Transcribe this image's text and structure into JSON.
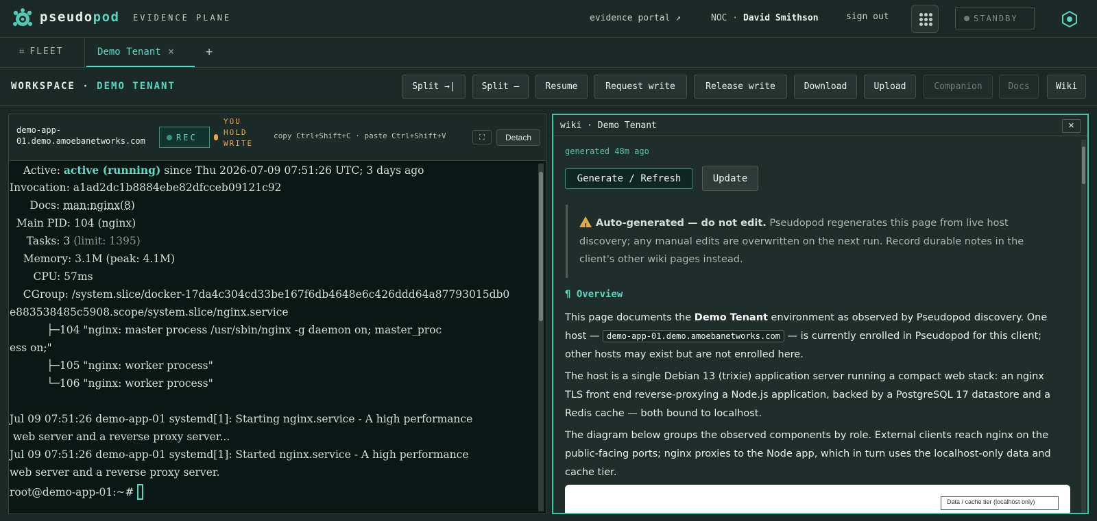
{
  "app": {
    "brand_prefix": "pseudo",
    "brand_suffix": "pod",
    "subtitle": "EVIDENCE PLANE",
    "icons": {
      "logo": "pseudopod-logo",
      "apps": "grid-dots-icon",
      "status": "hexagon-icon"
    }
  },
  "topbar": {
    "evidence_portal": "evidence portal ↗",
    "user_role": "NOC ·",
    "user_name": "David Smithson",
    "sign_out": "sign out",
    "standby": "STANDBY"
  },
  "tabs": {
    "fleet_icon": "⌗",
    "fleet_label": "FLEET",
    "active_label": "Demo Tenant",
    "close_glyph": "×",
    "add_glyph": "+"
  },
  "workspace": {
    "title_prefix": "WORKSPACE ·",
    "title_tenant": "DEMO TENANT",
    "buttons": {
      "split_v": "Split →|",
      "split_h": "Split —",
      "resume": "Resume",
      "request_write": "Request write",
      "release_write": "Release write",
      "download": "Download",
      "upload": "Upload",
      "companion": "Companion",
      "docs": "Docs",
      "wiki": "Wiki"
    }
  },
  "terminal": {
    "host": "demo-app-01.demo.amoebanetworks.com",
    "rec": "REC",
    "hold_write": "YOU HOLD WRITE",
    "copy_hint": "copy Ctrl+Shift+C · paste Ctrl+Shift+V",
    "expand_icon": "⛶",
    "detach": "Detach",
    "lines": {
      "active_label": "    Active: ",
      "active_state": "active (running)",
      "active_rest": " since Thu 2026-07-09 07:51:26 UTC; 3 days ago",
      "invocation": "Invocation: a1ad2dc1b8884ebe82dfcceb09121c92",
      "docs_label": "      Docs: ",
      "docs_link": "man:nginx(8)",
      "main_pid": "  Main PID: 104 (nginx)",
      "tasks_label": "     Tasks: 3 ",
      "tasks_limit": "(limit: 1395)",
      "memory": "    Memory: 3.1M (peak: 4.1M)",
      "cpu": "       CPU: 57ms",
      "cgroup1": "    CGroup: /system.slice/docker-17da4c304cd33be167f6db4648e6c426ddd64a87793015db0",
      "cgroup2": "e883538485c5908.scope/system.slice/nginx.service",
      "proc1_tree": "           ├─",
      "proc1": "104 \"nginx: master process /usr/sbin/nginx -g daemon on; master_proc",
      "proc1_wrap": "ess on;\"",
      "proc2_tree": "           ├─",
      "proc2": "105 \"nginx: worker process\"",
      "proc3_tree": "           └─",
      "proc3": "106 \"nginx: worker process\"",
      "log1a": "Jul 09 07:51:26 demo-app-01 systemd[1]: Starting nginx.service - A high performance",
      "log1b": " web server and a reverse proxy server...",
      "log2a": "Jul 09 07:51:26 demo-app-01 systemd[1]: Started nginx.service - A high performance",
      "log2b": "web server and a reverse proxy server.",
      "prompt": "root@demo-app-01:~# "
    }
  },
  "wiki": {
    "title": "wiki · Demo Tenant",
    "close_glyph": "✕",
    "generated": "generated 48m ago",
    "generate_btn": "Generate / Refresh",
    "update_btn": "Update",
    "notice_bold": "Auto-generated — do not edit.",
    "notice_text": " Pseudopod regenerates this page from live host discovery; any manual edits are overwritten on the next run. Record durable notes in the client's other wiki pages instead.",
    "section": "¶ Overview",
    "p1_a": "This page documents the ",
    "p1_b": "Demo Tenant",
    "p1_c": " environment as observed by Pseudopod discovery. One host — ",
    "p1_code": "demo-app-01.demo.amoebanetworks.com",
    "p1_d": " — is currently enrolled in Pseudopod for this client; other hosts may exist but are not enrolled here.",
    "p2": "The host is a single Debian 13 (trixie) application server running a compact web stack: an nginx TLS front end reverse-proxying a Node.js application, backed by a PostgreSQL 17 datastore and a Redis cache — both bound to localhost.",
    "p3": "The diagram below groups the observed components by role. External clients reach nginx on the public-facing ports; nginx proxies to the Node app, which in turn uses the localhost-only data and cache tier.",
    "diagram_box": "Data / cache tier (localhost only)"
  }
}
